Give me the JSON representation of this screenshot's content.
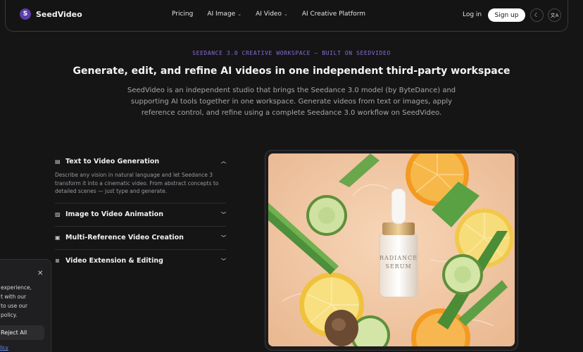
{
  "nav": {
    "brand_initial": "S",
    "brand_name": "SeedVideo",
    "links": [
      {
        "label": "Pricing",
        "dropdown": false
      },
      {
        "label": "AI Image",
        "dropdown": true
      },
      {
        "label": "AI Video",
        "dropdown": true
      },
      {
        "label": "AI Creative Platform",
        "dropdown": false
      }
    ],
    "login": "Log in",
    "signup": "Sign up",
    "theme_icon": "moon-icon",
    "language_icon": "translate-icon"
  },
  "hero": {
    "eyebrow": "SEEDANCE 3.0 CREATIVE WORKSPACE — BUILT ON SEEDVIDEO",
    "headline": "Generate, edit, and refine AI videos in one independent third-party workspace",
    "subtext": "SeedVideo is an independent studio that brings the Seedance 3.0 model (by ByteDance) and supporting AI tools together in one workspace. Generate videos from text or images, apply reference control, and refine using a complete Seedance 3.0 workflow on SeedVideo."
  },
  "features": [
    {
      "icon": "document-icon",
      "title": "Text to Video Generation",
      "expanded": true,
      "body": "Describe any vision in natural language and let Seedance 3 transform it into a cinematic video. From abstract concepts to detailed scenes — just type and generate."
    },
    {
      "icon": "image-icon",
      "title": "Image to Video Animation",
      "expanded": false
    },
    {
      "icon": "layers-icon",
      "title": "Multi-Reference Video Creation",
      "expanded": false
    },
    {
      "icon": "edit-icon",
      "title": "Video Extension & Editing",
      "expanded": false
    }
  ],
  "preview": {
    "bottle_line1": "RADIANCE",
    "bottle_line2": "SERUM"
  },
  "cookie": {
    "text_lines": [
      "experience,",
      "t with our",
      "to use our",
      "policy."
    ],
    "reject": "Reject All",
    "link": "licy"
  },
  "colors": {
    "background": "#151516",
    "accent": "#8a6bd6",
    "photo_bg": "#f2c8a6"
  }
}
